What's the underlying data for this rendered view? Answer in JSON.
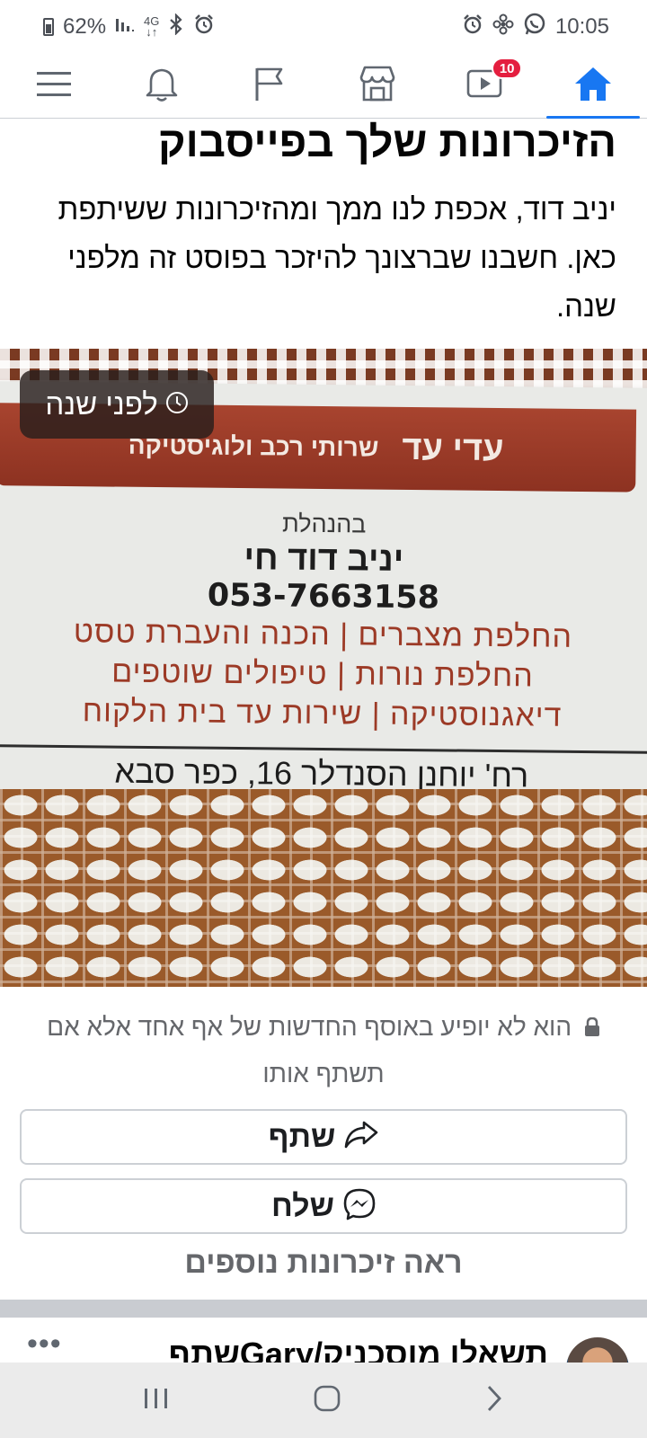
{
  "status_bar": {
    "battery": "62%",
    "time": "10:05",
    "network": "4G",
    "icons_left": [
      "battery-icon",
      "signal-icon",
      "network-4g-icon",
      "bluetooth-icon",
      "alarm-icon"
    ],
    "icons_right": [
      "alarm-icon",
      "fan-icon",
      "whatsapp-icon"
    ]
  },
  "top_nav": {
    "items": [
      "menu-icon",
      "notifications-icon",
      "pages-flag-icon",
      "marketplace-icon",
      "watch-icon",
      "home-icon"
    ],
    "active": "home-icon",
    "watch_badge": "10",
    "accent_color": "#1877f2",
    "badge_color": "#e41e3f"
  },
  "memory": {
    "title": "הזיכרונות שלך בפייסבוק",
    "text": "יניב דוד, אכפת לנו ממך ומהזיכרונות ששיתפת כאן. חשבנו שברצונך להיזכר בפוסט זה מלפני שנה.",
    "time_badge": "לפני שנה",
    "photo": {
      "banner_name": "עדי עד",
      "banner_subtitle": "שרותי רכב ולוגיסטיקה",
      "management": "בהנהלת",
      "person": "יניב דוד חי",
      "phone": "053-7663158",
      "services": [
        "החלפת מצברים | הכנה והעברת טסט",
        "החלפת נורות | טיפולים שוטפים",
        "דיאגנוסטיקה | שירות עד בית הלקוח"
      ],
      "address": "רח' יוחנן הסנדלר 16, כפר סבא"
    },
    "privacy_note": "הוא לא יופיע באוסף החדשות של אף אחד אלא אם תשתף אותו",
    "share_label": "שתף",
    "send_label": "שלח",
    "see_more": "ראה זיכרונות נוספים"
  },
  "next_post": {
    "author_partial": "תשאלו מוסכניק/Gary‏שתף",
    "more_label": "•••"
  },
  "android_nav": [
    "recent-apps-icon",
    "home-circle-icon",
    "back-chevron-icon"
  ]
}
